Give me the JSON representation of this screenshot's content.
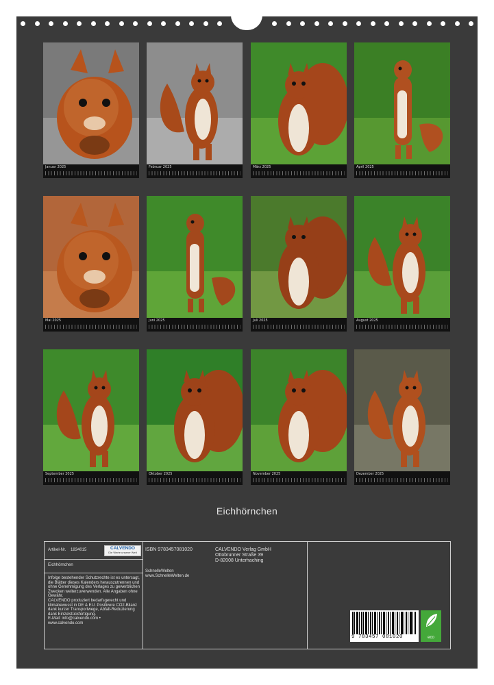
{
  "calendar": {
    "title": "Eichhörnchen",
    "months": [
      {
        "label": "Januar 2025",
        "photo": "squirrel-closeup-eating-nut"
      },
      {
        "label": "Februar 2025",
        "photo": "squirrel-standing-gravel"
      },
      {
        "label": "März 2025",
        "photo": "squirrel-in-grass-front"
      },
      {
        "label": "April 2025",
        "photo": "squirrel-reaching-up-grass"
      },
      {
        "label": "Mai 2025",
        "photo": "squirrel-face-closeup"
      },
      {
        "label": "Juni 2025",
        "photo": "squirrel-upright-grass"
      },
      {
        "label": "Juli 2025",
        "photo": "squirrel-sitting-upright"
      },
      {
        "label": "August 2025",
        "photo": "squirrel-standing-lawn"
      },
      {
        "label": "September 2025",
        "photo": "two-squirrels-grass"
      },
      {
        "label": "Oktober 2025",
        "photo": "squirrel-climbing-greenery"
      },
      {
        "label": "November 2025",
        "photo": "squirrel-in-meadow"
      },
      {
        "label": "Dezember 2025",
        "photo": "squirrel-on-tree-stump"
      }
    ]
  },
  "info": {
    "article_label": "Artikel-Nr.",
    "article_no": "1834015",
    "logo_text": "CALVENDO",
    "logo_sub": "Die Werte unserer Welt",
    "product_title": "Eichhörnchen",
    "legal_text": "Infolge bestehender Schutzrechte ist es untersagt, die Blätter dieses Kalenders herauszutrennen und ohne Genehmigung des Verlages zu gewerblichen Zwecken weiterzuverwenden. Alle Angaben ohne Gewähr.",
    "eco_text": "CALVENDO produziert bedarfsgerecht und klimabewusst in DE & EU. Positivere CO2-Bilanz dank kurzer Transportwege, Abfall-Reduzierung dank Einzelstückfertigung.",
    "email": "E-Mail: info@calvendo.com •",
    "website": "www.calvendo.com",
    "isbn": "ISBN 9783457081020",
    "author": "SchnelleWelten",
    "author_url": "www.SchnelleWelten.de",
    "publisher": "CALVENDO Verlag GmbH",
    "street": "Ottobrunner Straße 39",
    "city": "D-82008 Unterhaching",
    "barcode_number": "9 783457 081020",
    "eco_badge": "eco"
  }
}
